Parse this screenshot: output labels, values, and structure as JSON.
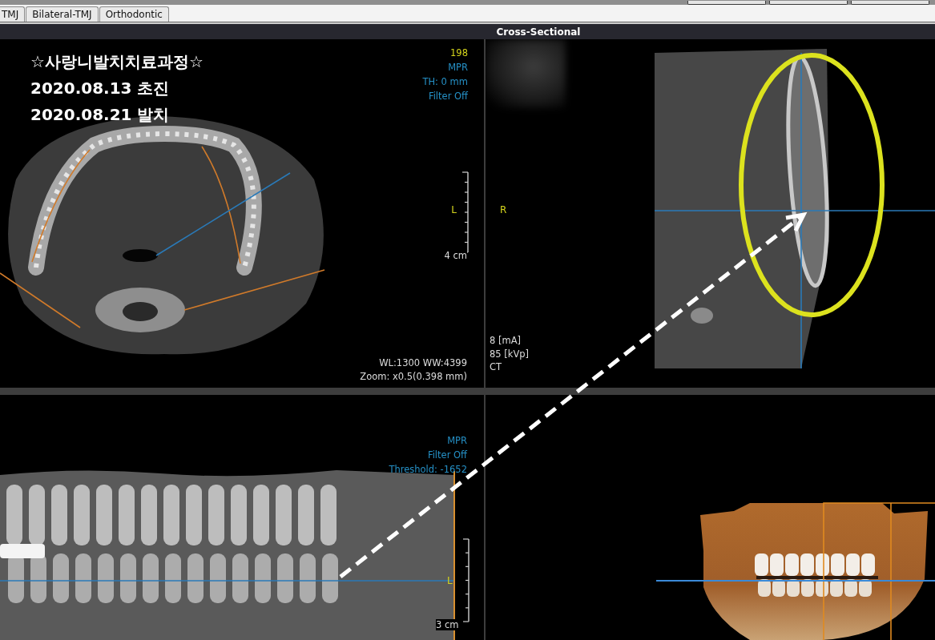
{
  "tabs": [
    {
      "label": "TMJ",
      "selected": false
    },
    {
      "label": "Bilateral-TMJ",
      "selected": false
    },
    {
      "label": "Orthodontic",
      "selected": false
    }
  ],
  "view_title": "Cross-Sectional",
  "axial_view": {
    "annotation": {
      "title": "☆사랑니발치치료과정☆",
      "dates": [
        "2020.08.13 초진",
        "2020.08.21 발치"
      ]
    },
    "info_lines": [
      {
        "kind": "slice",
        "text": "198"
      },
      {
        "kind": "setting",
        "text": "MPR"
      },
      {
        "kind": "setting",
        "text": "TH: 0 mm"
      },
      {
        "kind": "setting",
        "text": "Filter Off"
      }
    ],
    "orientation_marker": "L",
    "scale_label": "4 cm",
    "display_lines": [
      "WL:1300 WW:4399",
      "Zoom: x0.5(0.398 mm)"
    ]
  },
  "cross_sectional_view": {
    "orientation_marker": "R",
    "acquisition_lines": [
      "8 [mA]",
      "85 [kVp]",
      "CT"
    ]
  },
  "panoramic_view": {
    "info_lines": [
      {
        "kind": "setting",
        "text": "MPR"
      },
      {
        "kind": "setting",
        "text": "Filter Off"
      },
      {
        "kind": "setting",
        "text": "Threshold: -1652"
      }
    ],
    "orientation_marker": "L",
    "scale_label": "3 cm"
  }
}
